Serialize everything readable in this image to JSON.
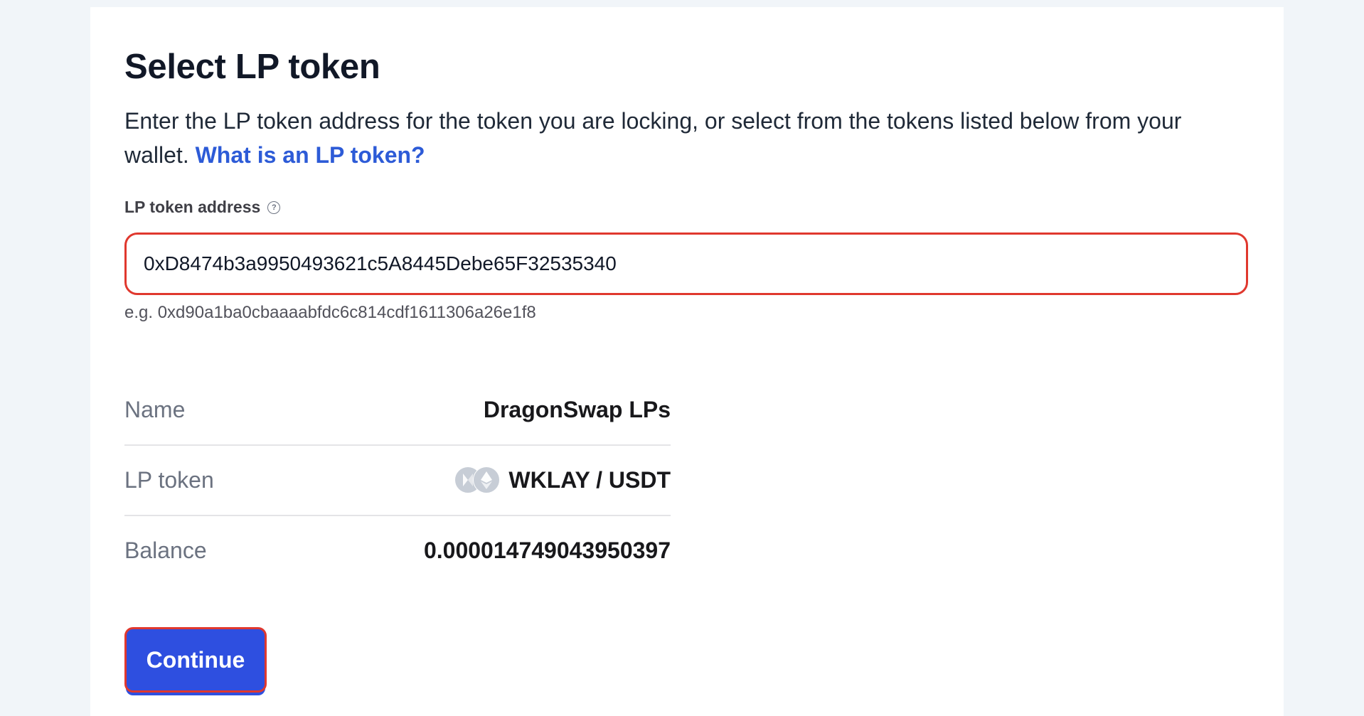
{
  "page": {
    "title": "Select LP token",
    "description": "Enter the LP token address for the token you are locking, or select from the tokens listed below from your wallet.",
    "help_link": "What is an LP token?"
  },
  "address_field": {
    "label": "LP token address",
    "help_icon": "?",
    "value": "0xD8474b3a9950493621c5A8445Debe65F32535340",
    "hint": "e.g. 0xd90a1ba0cbaaaabfdc6c814cdf1611306a26e1f8"
  },
  "token_info": {
    "name_label": "Name",
    "name_value": "DragonSwap LPs",
    "lp_label": "LP token",
    "lp_value": "WKLAY / USDT",
    "lp_icons": [
      "klay-icon",
      "ethereum-icon"
    ],
    "balance_label": "Balance",
    "balance_value": "0.000014749043950397"
  },
  "actions": {
    "continue_label": "Continue"
  },
  "colors": {
    "accent": "#2e4fe0",
    "link": "#2d5bd7",
    "highlight_border": "#e0382e",
    "background": "#f1f5f9"
  }
}
